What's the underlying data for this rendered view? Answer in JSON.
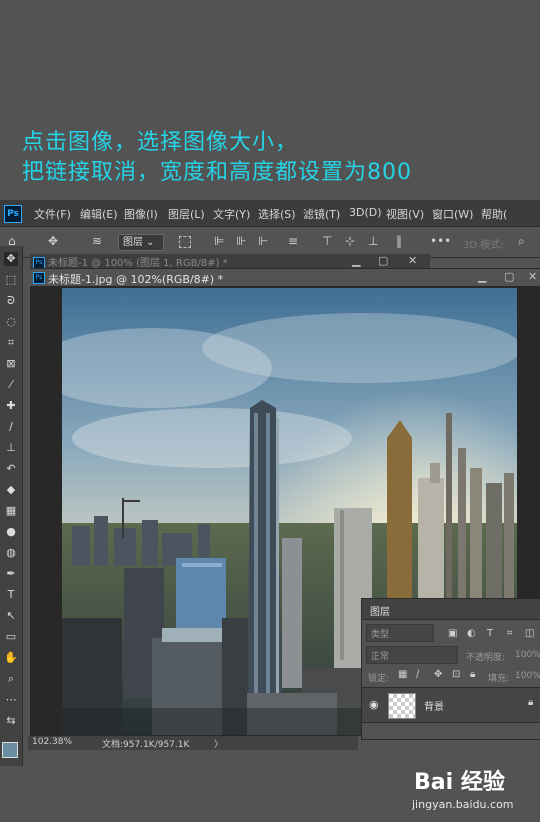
{
  "caption": {
    "line1": "点击图像，选择图像大小，",
    "line2": "把链接取消，宽度和高度都设置为800"
  },
  "app": {
    "logo": "Ps"
  },
  "menu": [
    "文件(F)",
    "编辑(E)",
    "图像(I)",
    "图层(L)",
    "文字(Y)",
    "选择(S)",
    "滤镜(T)",
    "3D(D)",
    "视图(V)",
    "窗口(W)",
    "帮助("
  ],
  "options": {
    "layer_select": "图层",
    "mode_label": "3D 模式:",
    "icons": [
      "move-icon",
      "layer-stack-icon",
      "transform-icon",
      "align-icons",
      "more-icon",
      "search-icon"
    ]
  },
  "tabs": {
    "back": "未标题-1 @ 100% (图层 1, RGB/8#) *",
    "front": "未标题-1.jpg @ 102%(RGB/8#) *",
    "minimize": "▁",
    "maximize": "▢",
    "close": "✕"
  },
  "status": {
    "zoom": "102.38%",
    "doc": "文档:957.1K/957.1K",
    "arrow": "〉"
  },
  "layers_panel": {
    "title": "图层",
    "kind_filter": "类型",
    "blend_mode": "正常",
    "opacity_label": "不透明度:",
    "opacity_value": "100%",
    "lock_label": "锁定:",
    "fill_label": "填充:",
    "fill_value": "100%",
    "layer_name": "背景"
  },
  "watermark": {
    "logo": "Bai 经验",
    "sub": "jingyan.baidu.com"
  },
  "colors": {
    "caption": "#25d4e6",
    "foreground": "#6a8da2",
    "ps_blue": "#31a8ff"
  }
}
